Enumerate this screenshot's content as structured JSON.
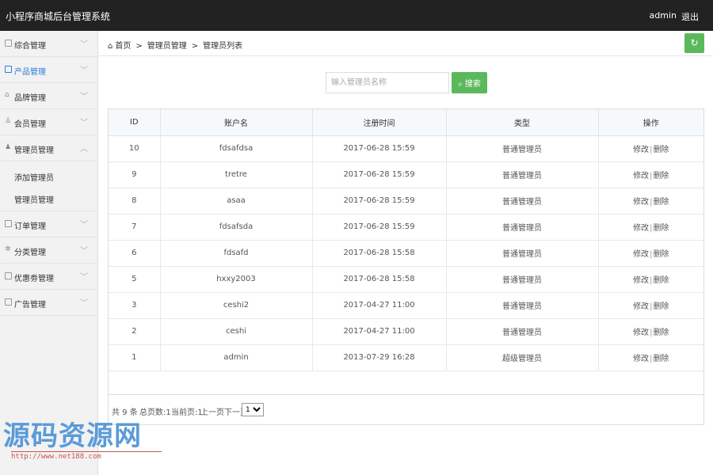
{
  "header": {
    "title": "小程序商城后台管理系统",
    "user": "admin",
    "logout": "退出"
  },
  "sidebar": {
    "items": [
      {
        "label": "综合管理",
        "icon": "document-icon"
      },
      {
        "label": "产品管理",
        "icon": "image-icon",
        "active": true
      },
      {
        "label": "品牌管理",
        "icon": "shop-icon"
      },
      {
        "label": "会员管理",
        "icon": "user-icon"
      },
      {
        "label": "管理员管理",
        "icon": "admin-user-icon",
        "expanded": true
      },
      {
        "label": "订单管理",
        "icon": "file-icon"
      },
      {
        "label": "分类管理",
        "icon": "cog-icon"
      },
      {
        "label": "优惠劵管理",
        "icon": "coupon-icon"
      },
      {
        "label": "广告管理",
        "icon": "ad-icon"
      }
    ],
    "sub_items": [
      {
        "label": "添加管理员"
      },
      {
        "label": "管理员管理"
      }
    ]
  },
  "breadcrumb": {
    "home": "首页",
    "level1": "管理员管理",
    "level2": "管理员列表"
  },
  "search": {
    "placeholder": "输入管理员名称",
    "button": "搜索"
  },
  "table": {
    "columns": [
      "ID",
      "账户名",
      "注册时间",
      "类型",
      "操作"
    ],
    "edit_label": "修改",
    "delete_label": "删除",
    "rows": [
      {
        "id": "10",
        "name": "fdsafdsa",
        "time": "2017-06-28 15:59",
        "type": "普通管理员"
      },
      {
        "id": "9",
        "name": "tretre",
        "time": "2017-06-28 15:59",
        "type": "普通管理员"
      },
      {
        "id": "8",
        "name": "asaa",
        "time": "2017-06-28 15:59",
        "type": "普通管理员"
      },
      {
        "id": "7",
        "name": "fdsafsda",
        "time": "2017-06-28 15:59",
        "type": "普通管理员"
      },
      {
        "id": "6",
        "name": "fdsafd",
        "time": "2017-06-28 15:58",
        "type": "普通管理员"
      },
      {
        "id": "5",
        "name": "hxxy2003",
        "time": "2017-06-28 15:58",
        "type": "普通管理员"
      },
      {
        "id": "3",
        "name": "ceshi2",
        "time": "2017-04-27 11:00",
        "type": "普通管理员"
      },
      {
        "id": "2",
        "name": "ceshi",
        "time": "2017-04-27 11:00",
        "type": "普通管理员"
      },
      {
        "id": "1",
        "name": "admin",
        "time": "2013-07-29 16:28",
        "type": "超级管理员"
      }
    ]
  },
  "pager": {
    "total": "共 9 条",
    "pages": "总页数:1",
    "current": "当前页:1",
    "prev_next": "上一页下一页",
    "page_options": [
      "1"
    ],
    "selected_page": "1"
  },
  "watermark": {
    "logo": "源码资源网",
    "url": "http://www.net188.com"
  },
  "colors": {
    "topbar": "#222222",
    "accent_green": "#5cb85c",
    "active_link": "#2b7dd9"
  }
}
